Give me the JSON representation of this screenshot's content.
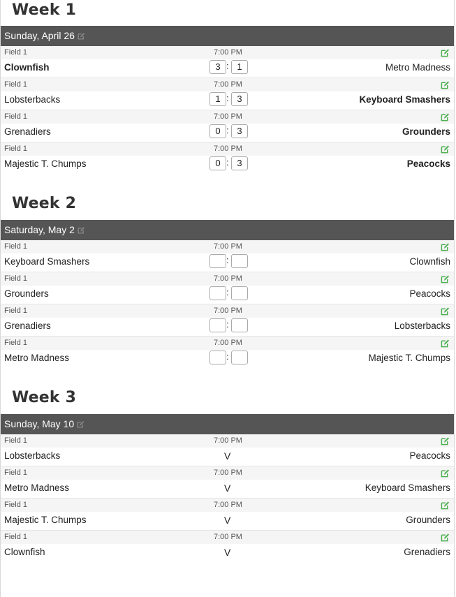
{
  "colors": {
    "edit_green": "#4caf50",
    "bar_bg": "#555555"
  },
  "icons": {
    "day_edit": "edit-icon",
    "game_edit": "edit-icon"
  },
  "weeks": [
    {
      "title": "Week 1",
      "day": "Sunday, April 26",
      "games": [
        {
          "field": "Field 1",
          "time": "7:00 PM",
          "home": "Clownfish",
          "away": "Metro Madness",
          "home_score": "3",
          "away_score": "1",
          "winner": "home",
          "status": "final"
        },
        {
          "field": "Field 1",
          "time": "7:00 PM",
          "home": "Lobsterbacks",
          "away": "Keyboard Smashers",
          "home_score": "1",
          "away_score": "3",
          "winner": "away",
          "status": "final"
        },
        {
          "field": "Field 1",
          "time": "7:00 PM",
          "home": "Grenadiers",
          "away": "Grounders",
          "home_score": "0",
          "away_score": "3",
          "winner": "away",
          "status": "final"
        },
        {
          "field": "Field 1",
          "time": "7:00 PM",
          "home": "Majestic T. Chumps",
          "away": "Peacocks",
          "home_score": "0",
          "away_score": "3",
          "winner": "away",
          "status": "final"
        }
      ]
    },
    {
      "title": "Week 2",
      "day": "Saturday, May 2",
      "games": [
        {
          "field": "Field 1",
          "time": "7:00 PM",
          "home": "Keyboard Smashers",
          "away": "Clownfish",
          "home_score": "",
          "away_score": "",
          "winner": "",
          "status": "entry"
        },
        {
          "field": "Field 1",
          "time": "7:00 PM",
          "home": "Grounders",
          "away": "Peacocks",
          "home_score": "",
          "away_score": "",
          "winner": "",
          "status": "entry"
        },
        {
          "field": "Field 1",
          "time": "7:00 PM",
          "home": "Grenadiers",
          "away": "Lobsterbacks",
          "home_score": "",
          "away_score": "",
          "winner": "",
          "status": "entry"
        },
        {
          "field": "Field 1",
          "time": "7:00 PM",
          "home": "Metro Madness",
          "away": "Majestic T. Chumps",
          "home_score": "",
          "away_score": "",
          "winner": "",
          "status": "entry"
        }
      ]
    },
    {
      "title": "Week 3",
      "day": "Sunday, May 10",
      "games": [
        {
          "field": "Field 1",
          "time": "7:00 PM",
          "home": "Lobsterbacks",
          "away": "Peacocks",
          "vs": "V",
          "winner": "",
          "status": "upcoming"
        },
        {
          "field": "Field 1",
          "time": "7:00 PM",
          "home": "Metro Madness",
          "away": "Keyboard Smashers",
          "vs": "V",
          "winner": "",
          "status": "upcoming"
        },
        {
          "field": "Field 1",
          "time": "7:00 PM",
          "home": "Majestic T. Chumps",
          "away": "Grounders",
          "vs": "V",
          "winner": "",
          "status": "upcoming"
        },
        {
          "field": "Field 1",
          "time": "7:00 PM",
          "home": "Clownfish",
          "away": "Grenadiers",
          "vs": "V",
          "winner": "",
          "status": "upcoming"
        }
      ]
    }
  ]
}
